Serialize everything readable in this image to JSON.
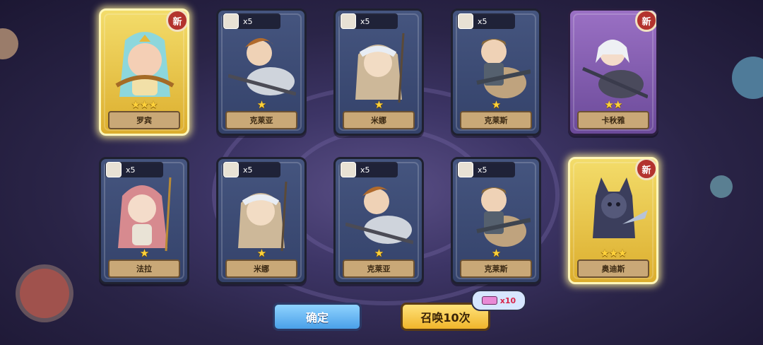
{
  "cards": [
    {
      "name": "罗宾",
      "stars": "★★★",
      "style": "gold",
      "badge": "新",
      "count": ""
    },
    {
      "name": "克莱亚",
      "stars": "★",
      "style": "blue",
      "badge": "",
      "count": "x5"
    },
    {
      "name": "米娜",
      "stars": "★",
      "style": "blue",
      "badge": "",
      "count": "x5"
    },
    {
      "name": "克莱斯",
      "stars": "★",
      "style": "blue",
      "badge": "",
      "count": "x5"
    },
    {
      "name": "卡秋雅",
      "stars": "★★",
      "style": "purple",
      "badge": "新",
      "count": ""
    },
    {
      "name": "法拉",
      "stars": "★",
      "style": "blue",
      "badge": "",
      "count": "x5"
    },
    {
      "name": "米娜",
      "stars": "★",
      "style": "blue",
      "badge": "",
      "count": "x5"
    },
    {
      "name": "克莱亚",
      "stars": "★",
      "style": "blue",
      "badge": "",
      "count": "x5"
    },
    {
      "name": "克莱斯",
      "stars": "★",
      "style": "blue",
      "badge": "",
      "count": "x5"
    },
    {
      "name": "奥迪斯",
      "stars": "★★★",
      "style": "gold",
      "badge": "新",
      "count": ""
    }
  ],
  "buttons": {
    "confirm": "确定",
    "summon": "召唤10次"
  },
  "cost": {
    "icon": "eraser-ticket-icon",
    "amount": "x10"
  },
  "colors": {
    "gold": "#dcae2e",
    "blue": "#34426a",
    "purple": "#6b4a99",
    "badge": "#b3332e"
  }
}
